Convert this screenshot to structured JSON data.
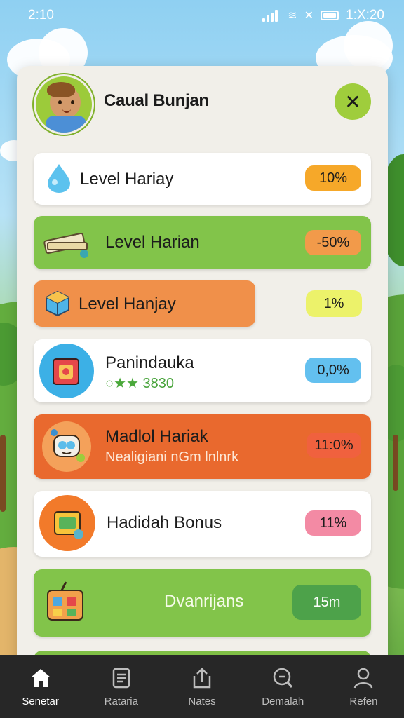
{
  "status_bar": {
    "time": "2:10",
    "right_time": "1:X:20"
  },
  "profile": {
    "username": "Caual Bunjan",
    "close_label": "✕"
  },
  "rows": [
    {
      "label": "Level Hariay",
      "value": "10%",
      "icon": "water-drop-icon"
    },
    {
      "label": "Level Harian",
      "value": "-50%",
      "icon": "book-icon"
    },
    {
      "label": "Level Hanjay",
      "value": "1%",
      "icon": "cube-icon"
    },
    {
      "label": "Panindauka",
      "sub": "3830",
      "value": "0,0%",
      "icon": "gift-box-icon"
    },
    {
      "label": "Madlol Hariak",
      "sub": "Nealigiani nGm lnlnrk",
      "value": "11:0%",
      "icon": "robot-icon"
    },
    {
      "label": "Hadidah Bonus",
      "value": "11%",
      "icon": "treasure-icon"
    },
    {
      "label": "Dvanrijans",
      "value": "15m",
      "icon": "toy-box-icon"
    }
  ],
  "nav": [
    {
      "label": "Senetar",
      "icon": "home-icon",
      "active": true
    },
    {
      "label": "Rataria",
      "icon": "list-icon"
    },
    {
      "label": "Nates",
      "icon": "upload-icon"
    },
    {
      "label": "Demalah",
      "icon": "search-icon"
    },
    {
      "label": "Refen",
      "icon": "person-icon"
    }
  ],
  "colors": {
    "row_white": "#ffffff",
    "row_green": "#82c44a",
    "row_orange": "#f0904a",
    "row_deep_orange": "#e9692e",
    "pill_orange": "#f6a829",
    "pill_yellow": "#ecf26a",
    "pill_blue": "#63c0ef",
    "pill_pink": "#f38aa4",
    "pill_green": "#4da24a"
  }
}
